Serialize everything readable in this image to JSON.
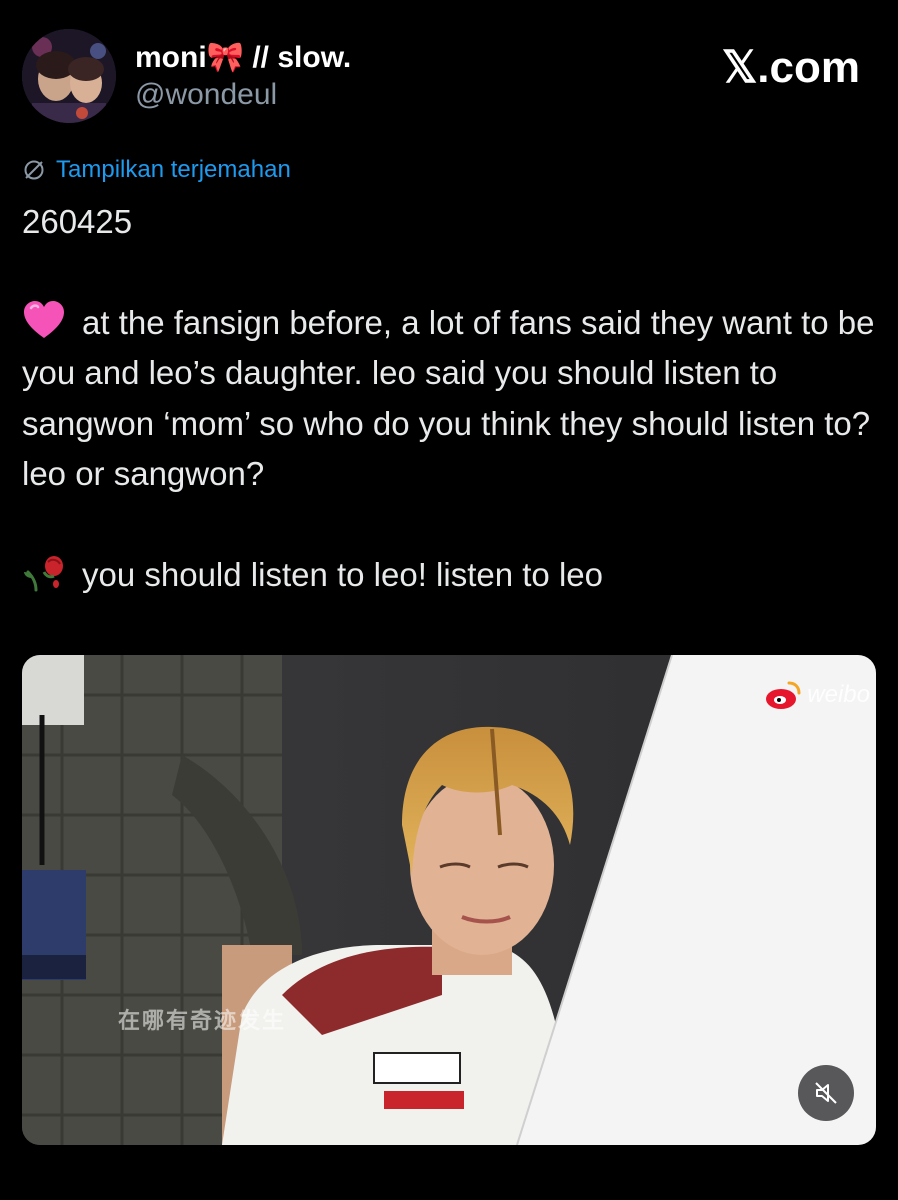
{
  "header": {
    "display_name": "moni🎀 // slow.",
    "handle": "@wondeul",
    "site_logo": "𝕏.com"
  },
  "translate": {
    "label": "Tampilkan terjemahan",
    "icon": "globe-icon"
  },
  "tweet": {
    "line_1": "260425",
    "question": "at the fansign before, a lot of fans said they want to be you and leo’s daughter. leo said you should listen to sangwon ‘mom’ so who do you think they should listen to? leo or sangwon?",
    "answer": "you should listen to leo! listen to leo",
    "question_emoji": "pink-heart-icon",
    "answer_emoji": "wilted-rose-icon"
  },
  "media": {
    "watermark": "weibo",
    "caption": "在哪有奇迹发生",
    "mute_icon": "mute-speaker-icon",
    "colors": {
      "background": "#2a2a2c",
      "hair": "#d9a44a",
      "card": "#f4f4f4"
    }
  },
  "colors": {
    "background": "#000000",
    "text": "#e7e9ea",
    "secondary": "#8b98a5",
    "link": "#1d9bf0"
  }
}
